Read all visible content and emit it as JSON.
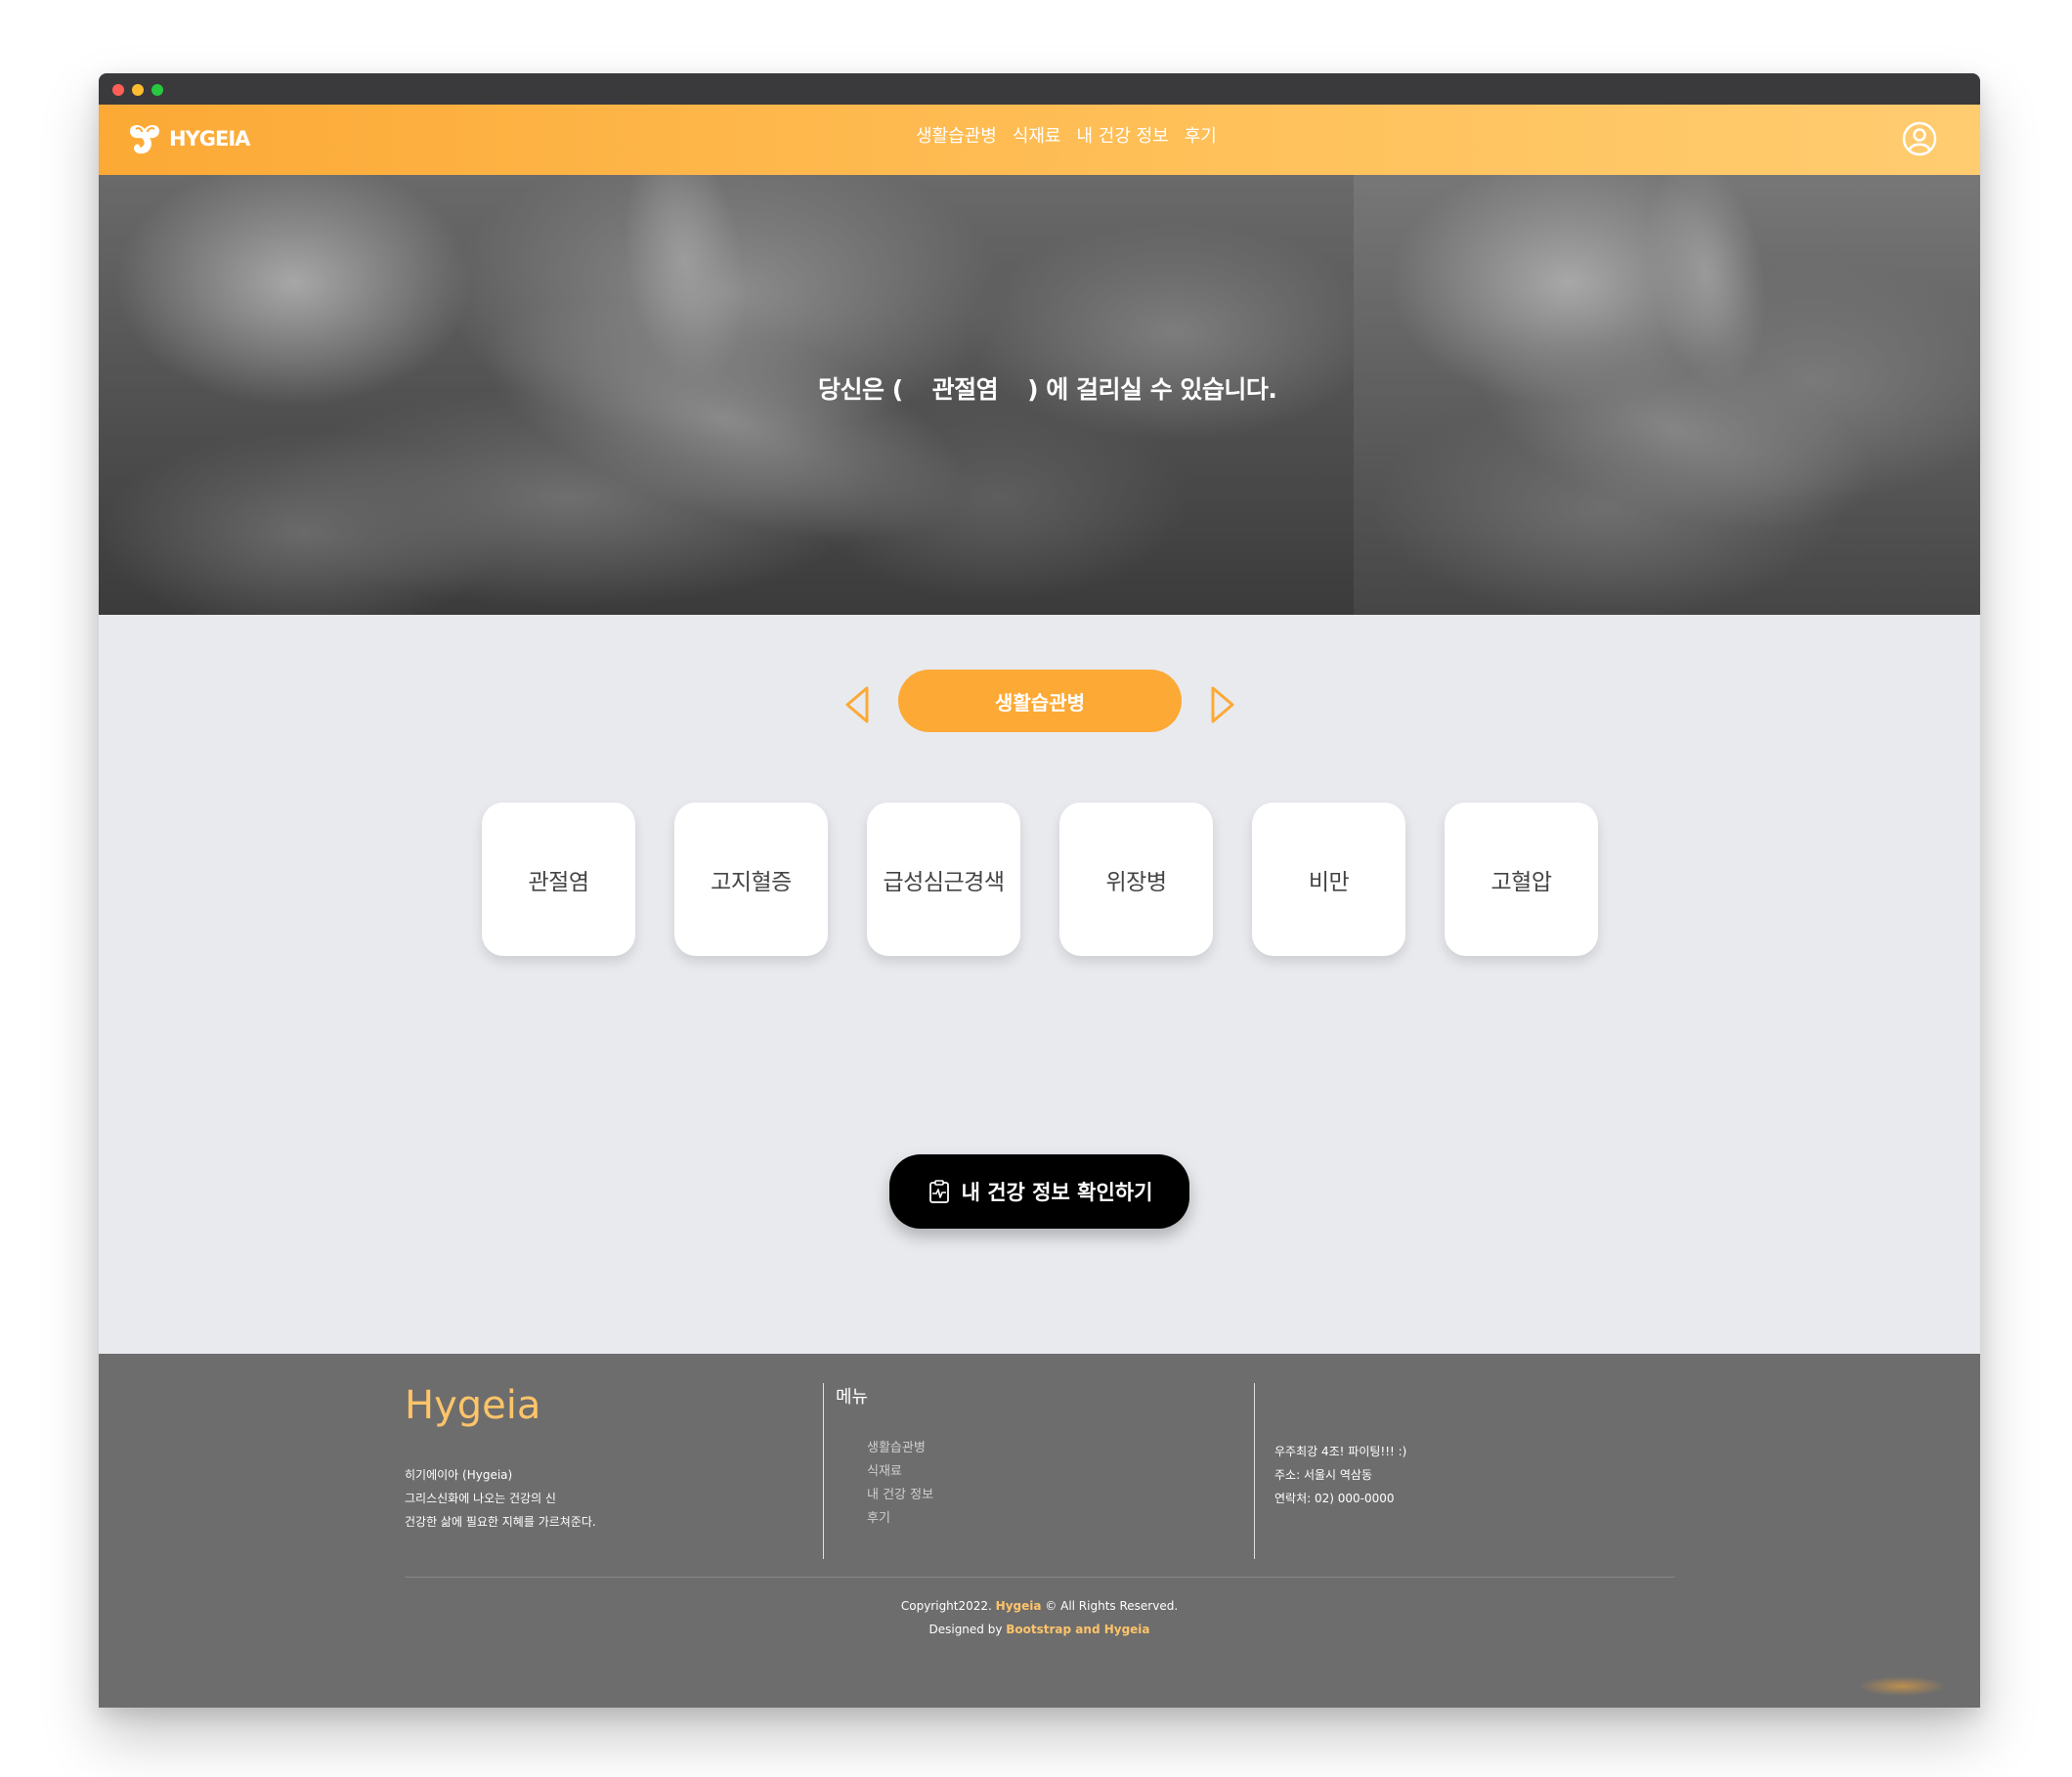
{
  "brand": {
    "logo_text": "HYGEIA",
    "accent_color": "#fca935"
  },
  "nav": {
    "links": [
      "생활습관병",
      "식재료",
      "내 건강 정보",
      "후기"
    ],
    "user_icon": "user-circle-icon"
  },
  "hero": {
    "prefix": "당신은 (",
    "disease": "관절염",
    "suffix": ") 에 걸리실 수 있습니다."
  },
  "category": {
    "current": "생활습관병",
    "prev_icon": "triangle-left-icon",
    "next_icon": "triangle-right-icon"
  },
  "diseases": [
    "관절염",
    "고지혈증",
    "급성심근경색",
    "위장병",
    "비만",
    "고혈압"
  ],
  "check_button": {
    "label": "내 건강 정보 확인하기",
    "icon": "clipboard-health-icon"
  },
  "footer": {
    "brand": "Hygeia",
    "desc": [
      "히기에이아 (Hygeia)",
      "그리스신화에 나오는 건강의 신",
      "건강한 삶에 필요한 지혜를 가르쳐준다."
    ],
    "menu_title": "메뉴",
    "menu_items": [
      "생활습관병",
      "식재료",
      "내 건강 정보",
      "후기"
    ],
    "contact": [
      "우주최강 4조! 파이팅!!! :)",
      "주소: 서울시 역삼동",
      "연락처: 02) 000-0000"
    ],
    "copyright_prefix": "Copyright2022. ",
    "copyright_brand": "Hygeia",
    "copyright_suffix": " © All Rights Reserved.",
    "designed_prefix": "Designed by ",
    "designed_by": "Bootstrap and Hygeia"
  }
}
